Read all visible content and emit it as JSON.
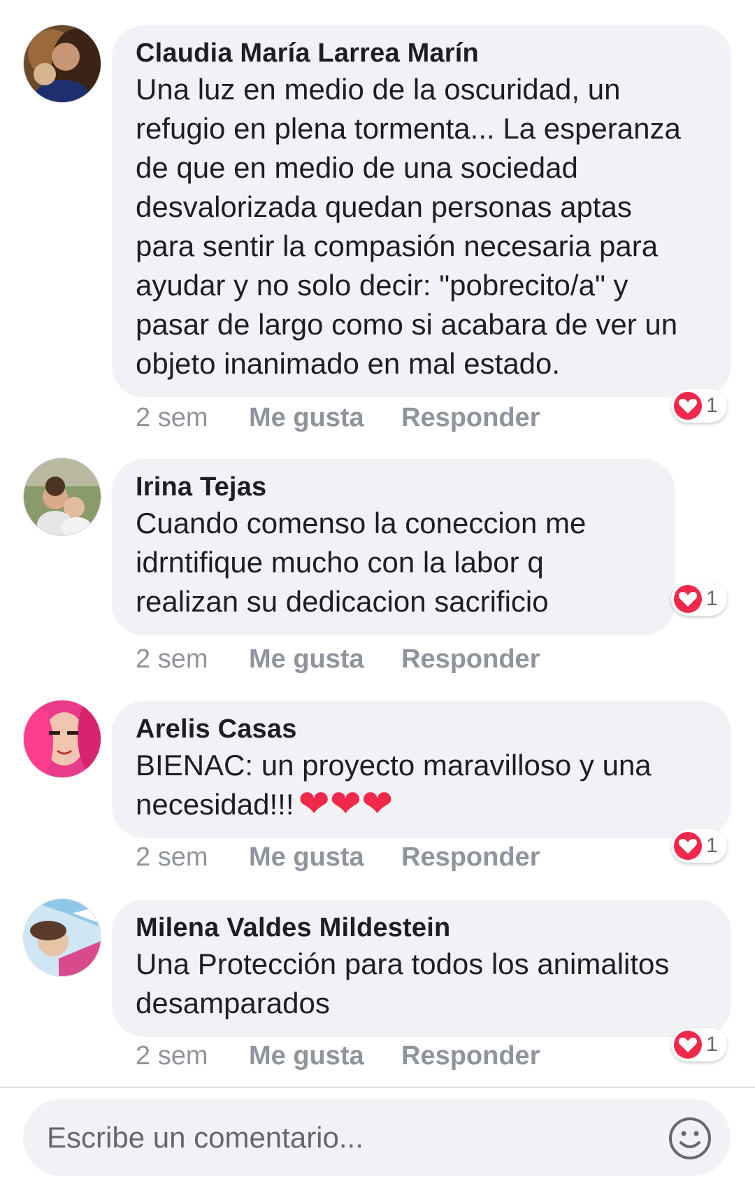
{
  "comments": [
    {
      "author": "Claudia María Larrea Marín",
      "text": "Una luz en medio de la oscuridad, un\nrefugio en plena tormenta... La esperanza\nde que en medio de una sociedad\ndesvalorizada quedan personas aptas\npara sentir la compasión necesaria para\nayudar y no solo decir: \"pobrecito/a\" y\npasar de largo como si acabara de ver un\nobjeto inanimado en mal estado.",
      "time": "2 sem",
      "like_label": "Me gusta",
      "reply_label": "Responder",
      "reaction_icon": "heart-icon",
      "reaction_count": "1"
    },
    {
      "author": "Irina Tejas",
      "text": "Cuando comenso la coneccion me\nidrntifique mucho con  la labor q\nrealizan su dedicacion sacrificio",
      "time": "2 sem",
      "like_label": "Me gusta",
      "reply_label": "Responder",
      "reaction_icon": "heart-icon",
      "reaction_count": "1"
    },
    {
      "author": "Arelis Casas",
      "text": "BIENAC: un proyecto maravilloso y una\nnecesidad!!!",
      "emoji": "❤❤❤",
      "time": "2 sem",
      "like_label": "Me gusta",
      "reply_label": "Responder",
      "reaction_icon": "heart-icon",
      "reaction_count": "1"
    },
    {
      "author": "Milena Valdes Mildestein",
      "text": "Una Protección para todos los animalitos\ndesamparados",
      "time": "2 sem",
      "like_label": "Me gusta",
      "reply_label": "Responder",
      "reaction_icon": "heart-icon",
      "reaction_count": "1"
    }
  ],
  "composer": {
    "placeholder": "Escribe un comentario...",
    "emoji_icon": "smiley-icon"
  },
  "colors": {
    "bubble": "#f0f2f5",
    "meta_text": "#90949c",
    "heart_red": "#f0284a"
  }
}
